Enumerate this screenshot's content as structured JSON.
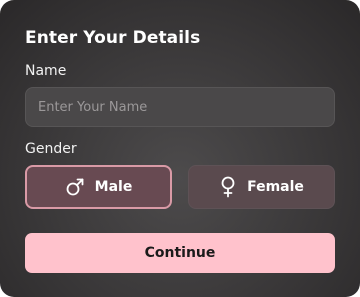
{
  "form": {
    "title": "Enter Your Details",
    "name_label": "Name",
    "name_placeholder": "Enter Your Name",
    "name_value": "",
    "gender_label": "Gender",
    "gender_options": [
      {
        "label": "Male",
        "icon": "male-icon",
        "selected": true
      },
      {
        "label": "Female",
        "icon": "female-icon",
        "selected": false
      }
    ],
    "continue_label": "Continue"
  },
  "colors": {
    "accent": "#ffc2cc",
    "selected_border": "#d99aa6",
    "card_background": "#3a3839"
  }
}
